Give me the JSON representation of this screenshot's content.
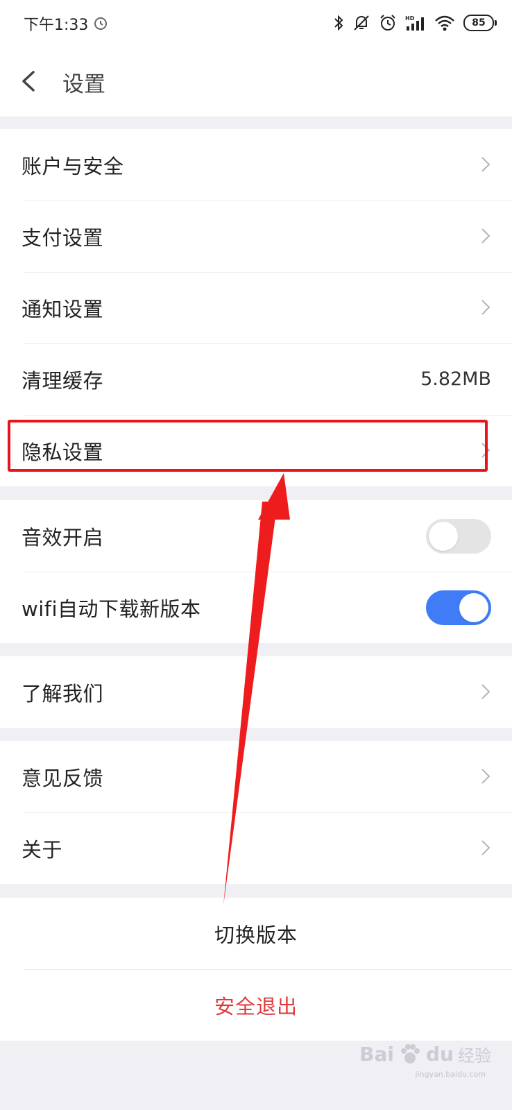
{
  "status_bar": {
    "time": "下午1:33",
    "battery": "85",
    "icons": [
      "alarm-icon",
      "bluetooth-icon",
      "mute-icon",
      "alarm-icon",
      "hd-signal-icon",
      "wifi-icon",
      "battery-icon"
    ]
  },
  "header": {
    "title": "设置",
    "back_icon": "chevron-left-icon"
  },
  "groups": {
    "account": {
      "items": [
        {
          "label": "账户与安全"
        },
        {
          "label": "支付设置"
        },
        {
          "label": "通知设置"
        },
        {
          "label": "清理缓存",
          "value": "5.82MB"
        },
        {
          "label": "隐私设置"
        }
      ]
    },
    "toggles": {
      "items": [
        {
          "label": "音效开启",
          "on": false
        },
        {
          "label": "wifi自动下载新版本",
          "on": true
        }
      ]
    },
    "about_us": {
      "items": [
        {
          "label": "了解我们"
        }
      ]
    },
    "feedback": {
      "items": [
        {
          "label": "意见反馈"
        },
        {
          "label": "关于"
        }
      ]
    },
    "actions": {
      "switch_version": "切换版本",
      "logout": "安全退出"
    }
  },
  "colors": {
    "accent": "#3f7cf6",
    "logout": "#e03b3b",
    "annotation": "#e8141b",
    "background": "#efeff4"
  },
  "watermark": {
    "brand": "Bai",
    "brand_2": "du",
    "sub": "经验",
    "url": "jingyan.baidu.com"
  }
}
